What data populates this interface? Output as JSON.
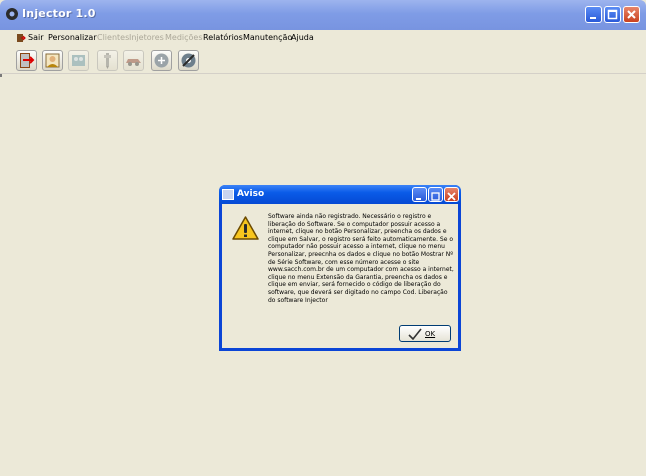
{
  "window": {
    "title": "Injector 1.0"
  },
  "menu": {
    "items": [
      {
        "label": "Sair",
        "enabled": true
      },
      {
        "label": "Personalizar",
        "enabled": true
      },
      {
        "label": "Clientes",
        "enabled": false
      },
      {
        "label": "Injetores",
        "enabled": false
      },
      {
        "label": "Medições",
        "enabled": false
      },
      {
        "label": "Relatórios",
        "enabled": true
      },
      {
        "label": "Manutenção",
        "enabled": true
      },
      {
        "label": "Ajuda",
        "enabled": true
      }
    ]
  },
  "toolbar": {
    "buttons": [
      {
        "icon": "exit-door-icon",
        "enabled": true
      },
      {
        "icon": "user-personalize-icon",
        "enabled": true
      },
      {
        "icon": "clients-icon",
        "enabled": false
      },
      {
        "icon": "injector-icon",
        "enabled": false
      },
      {
        "icon": "car-icon",
        "enabled": false
      },
      {
        "icon": "report-icon",
        "enabled": true
      },
      {
        "icon": "maintenance-icon",
        "enabled": true
      }
    ]
  },
  "dialog": {
    "title": "Aviso",
    "message": "Software ainda não registrado. Necessário o registro e liberação do Software. Se o computador possuir acesso a internet, clique no botão Personalizar, preencha os dados e clique em Salvar, o registro será feito automaticamente. Se o computador não possuir acesso a internet, clique no menu Personalizar, preecnha os dados e clique no botão Mostrar Nº de Série Software, com esse número acesse o site www.sacch.com.br de um computador com acesso a internet, clique no menu Extensão da Garantia, preencha os dados e clique em enviar, será fornecido o código de liberação do software, que deverá ser digitado no campo Cod. Liberação do software Injector",
    "ok_label": "OK",
    "icon": "warning-icon"
  },
  "colors": {
    "titlebar_active": "#7f9ce6",
    "dialog_titlebar": "#0a5be8",
    "background": "#ece9d8",
    "disabled_text": "#aca899"
  }
}
